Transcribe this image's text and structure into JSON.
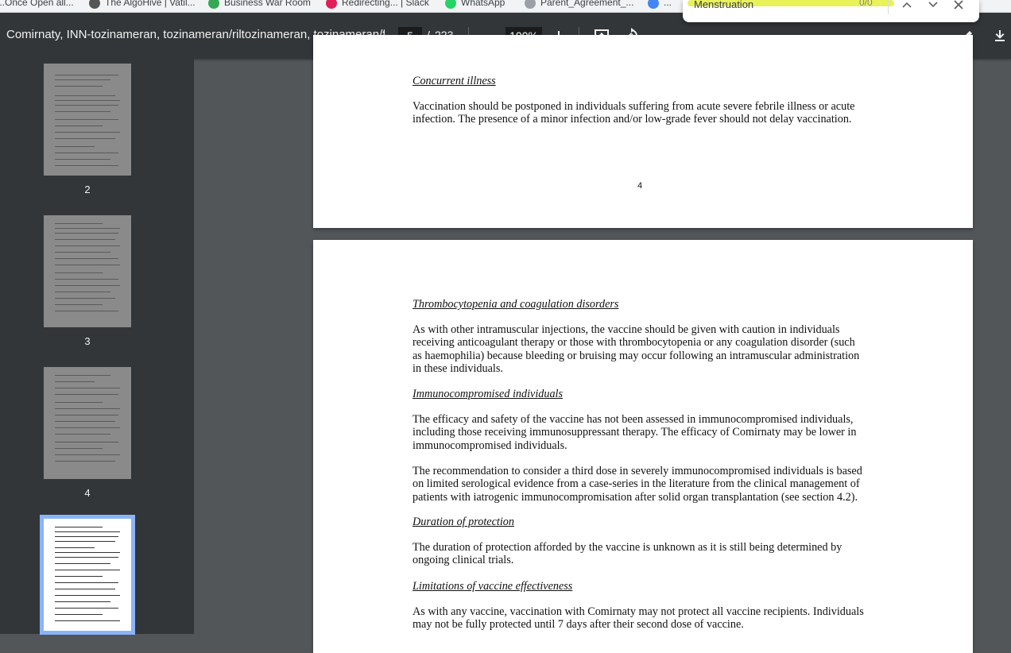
{
  "bookmarks": [
    {
      "label": "...Once Open all..."
    },
    {
      "label": "The AlgoHive | Vatil..."
    },
    {
      "label": "Business War Room"
    },
    {
      "label": "Redirecting... | Slack"
    },
    {
      "label": "WhatsApp"
    },
    {
      "label": "Parent_Agreement_..."
    },
    {
      "label": "..."
    }
  ],
  "toolbar": {
    "title": "Comirnaty, INN-tozinameran, tozinameran/riltozinameran, tozinameran/f...",
    "current_page": "5",
    "page_separator": "/",
    "total_pages": "223",
    "zoom": "100%"
  },
  "find": {
    "query": "Menstruation",
    "count": "0/0"
  },
  "thumbnails": [
    {
      "label": "2"
    },
    {
      "label": "3"
    },
    {
      "label": "4"
    },
    {
      "label": ""
    }
  ],
  "page4": {
    "heading": "Concurrent illness",
    "body": "Vaccination should be postponed in individuals suffering from acute severe febrile illness or acute infection. The presence of a minor infection and/or low-grade fever should not delay vaccination.",
    "page_number": "4"
  },
  "page5": {
    "sections": [
      {
        "heading": "Thrombocytopenia and coagulation disorders",
        "paragraphs": [
          "As with other intramuscular injections, the vaccine should be given with caution in individuals receiving anticoagulant therapy or those with thrombocytopenia or any coagulation disorder (such as haemophilia) because bleeding or bruising may occur following an intramuscular administration in these individuals."
        ]
      },
      {
        "heading": "Immunocompromised individuals",
        "paragraphs": [
          "The efficacy and safety of the vaccine has not been assessed in immunocompromised individuals, including those receiving immunosuppressant therapy. The efficacy of Comirnaty may be lower in immunocompromised individuals.",
          "The recommendation to consider a third dose in severely immunocompromised individuals is based on limited serological evidence from a case-series in the literature from the clinical management of patients with iatrogenic immunocompromisation after solid organ transplantation (see section 4.2)."
        ]
      },
      {
        "heading": "Duration of protection",
        "paragraphs": [
          "The duration of protection afforded by the vaccine is unknown as it is still being determined by ongoing clinical trials."
        ]
      },
      {
        "heading": "Limitations of vaccine effectiveness",
        "paragraphs": [
          "As with any vaccine, vaccination with Comirnaty may not protect all vaccine recipients. Individuals may not be fully protected until 7 days after their second dose of vaccine."
        ]
      }
    ]
  },
  "colors": {
    "toolbar_bg": "#323639",
    "viewer_bg": "#525659",
    "highlight": "#e6f03c",
    "selected_thumb_border": "#8ab4f8"
  }
}
